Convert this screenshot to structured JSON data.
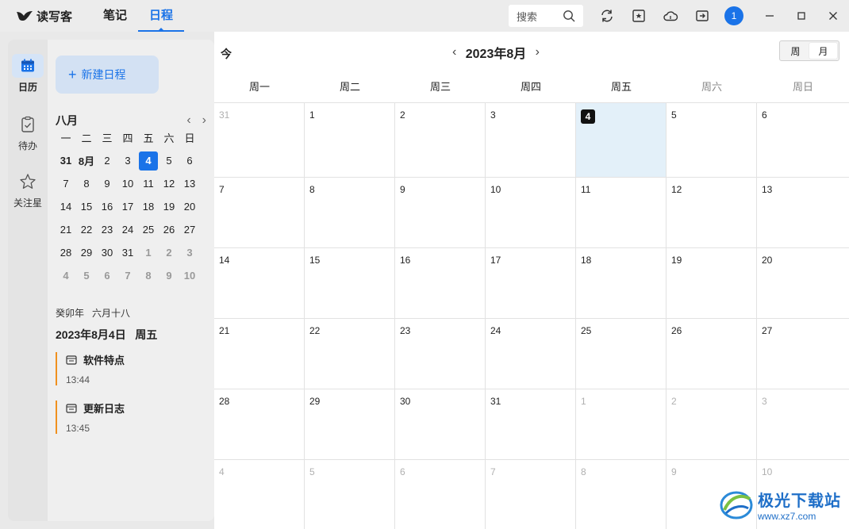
{
  "app": {
    "name": "读写客",
    "tabs": [
      {
        "label": "笔记",
        "active": false
      },
      {
        "label": "日程",
        "active": true
      }
    ],
    "search_placeholder": "搜索",
    "user_badge": "1",
    "accent": "#1a73e8"
  },
  "toolbar_icons": [
    "sync-icon",
    "bookmark-icon",
    "cloud-icon",
    "export-icon"
  ],
  "window_controls": [
    "minimize-icon",
    "maximize-icon",
    "close-icon"
  ],
  "rail": {
    "items": [
      {
        "label": "日历",
        "icon": "calendar-icon",
        "active": true
      },
      {
        "label": "待办",
        "icon": "clipboard-check-icon",
        "active": false
      },
      {
        "label": "关注星",
        "icon": "star-icon",
        "active": false
      }
    ]
  },
  "panel": {
    "new_event_label": "新建日程",
    "mini_month": "八月",
    "weekdays": [
      "一",
      "二",
      "三",
      "四",
      "五",
      "六",
      "日"
    ],
    "mini_days": [
      [
        "31",
        "8月",
        "2",
        "3",
        "4",
        "5",
        "6"
      ],
      [
        "7",
        "8",
        "9",
        "10",
        "11",
        "12",
        "13"
      ],
      [
        "14",
        "15",
        "16",
        "17",
        "18",
        "19",
        "20"
      ],
      [
        "21",
        "22",
        "23",
        "24",
        "25",
        "26",
        "27"
      ],
      [
        "28",
        "29",
        "30",
        "31",
        "1",
        "2",
        "3"
      ],
      [
        "4",
        "5",
        "6",
        "7",
        "8",
        "9",
        "10"
      ]
    ],
    "selected_day": "4",
    "lunar_text": "癸卯年   六月十八",
    "selected_date_text": "2023年8月4日   周五",
    "events": [
      {
        "title": "软件特点",
        "time": "13:44",
        "icon": "note-icon",
        "color": "#f0901e"
      },
      {
        "title": "更新日志",
        "time": "13:45",
        "icon": "note-icon",
        "color": "#f0901e"
      }
    ]
  },
  "main": {
    "today_label": "今",
    "month_title": "2023年8月",
    "view_week": "周",
    "view_month": "月",
    "active_view": "月",
    "week_headers": [
      "周一",
      "周二",
      "周三",
      "周四",
      "周五",
      "周六",
      "周日"
    ],
    "grid": [
      [
        "31",
        "1",
        "2",
        "3",
        "4",
        "5",
        "6"
      ],
      [
        "7",
        "8",
        "9",
        "10",
        "11",
        "12",
        "13"
      ],
      [
        "14",
        "15",
        "16",
        "17",
        "18",
        "19",
        "20"
      ],
      [
        "21",
        "22",
        "23",
        "24",
        "25",
        "26",
        "27"
      ],
      [
        "28",
        "29",
        "30",
        "31",
        "1",
        "2",
        "3"
      ],
      [
        "4",
        "5",
        "6",
        "7",
        "8",
        "9",
        "10"
      ]
    ],
    "today_text": "4",
    "today_bg": "#e3f0f9"
  },
  "watermark": {
    "title": "极光下载站",
    "url": "www.xz7.com"
  }
}
